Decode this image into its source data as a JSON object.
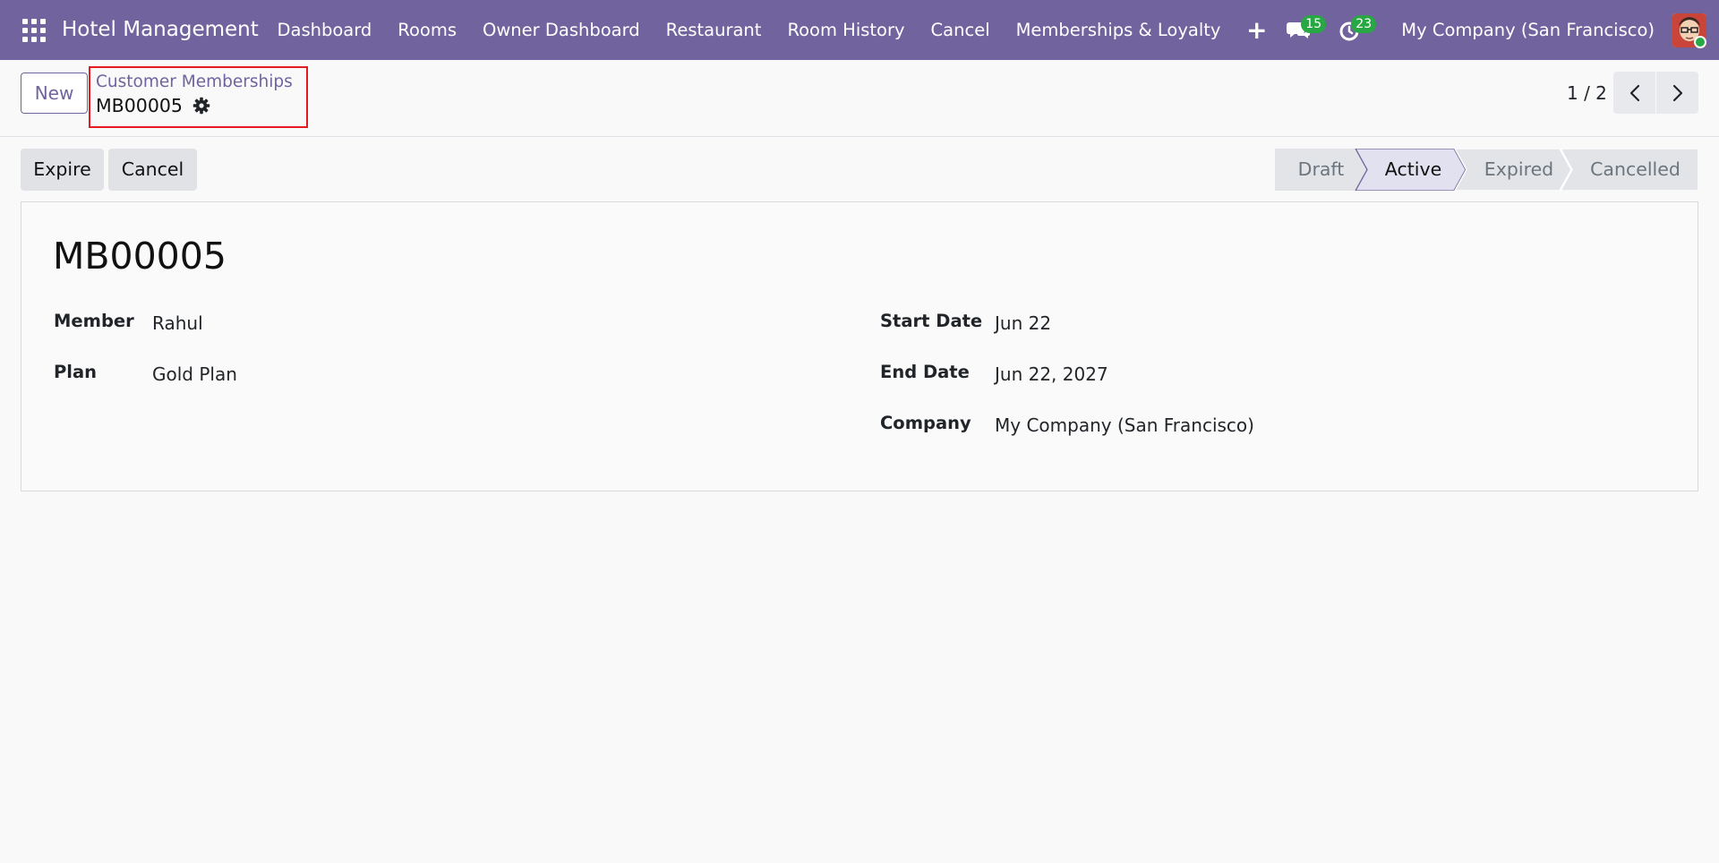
{
  "navbar": {
    "brand": "Hotel Management",
    "menu": [
      "Dashboard",
      "Rooms",
      "Owner Dashboard",
      "Restaurant",
      "Room History",
      "Cancel",
      "Memberships & Loyalty"
    ],
    "messages_count": "15",
    "activities_count": "23",
    "company": "My Company (San Francisco)",
    "bg_color": "#71639e"
  },
  "control_panel": {
    "new_label": "New",
    "breadcrumb_parent": "Customer Memberships",
    "breadcrumb_current": "MB00005",
    "pager": "1 / 2"
  },
  "actions": {
    "expire_label": "Expire",
    "cancel_label": "Cancel"
  },
  "statusbar": {
    "stages": [
      "Draft",
      "Active",
      "Expired",
      "Cancelled"
    ],
    "current": "Active"
  },
  "record": {
    "title": "MB00005",
    "fields_left": [
      {
        "label": "Member",
        "value": "Rahul"
      },
      {
        "label": "Plan",
        "value": "Gold Plan"
      }
    ],
    "fields_right": [
      {
        "label": "Start Date",
        "value": "Jun 22"
      },
      {
        "label": "End Date",
        "value": "Jun 22, 2027"
      },
      {
        "label": "Company",
        "value": "My Company (San Francisco)"
      }
    ]
  }
}
